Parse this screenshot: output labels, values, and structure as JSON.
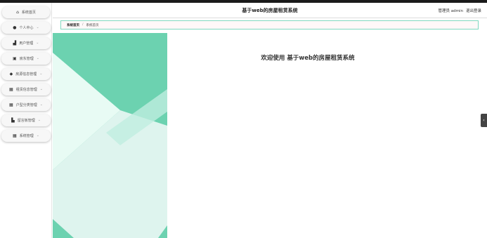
{
  "app": {
    "title": "基于web的房屋租赁系统"
  },
  "user": {
    "label": "管理员 admin",
    "logout": "退出登录"
  },
  "sidebar": {
    "items": [
      {
        "label": "系统首页",
        "icon": "home-icon",
        "glyph": "⌂",
        "chevron": ""
      },
      {
        "label": "个人中心",
        "icon": "user-icon",
        "glyph": "●",
        "chevron": "⌄"
      },
      {
        "label": "用户管理",
        "icon": "bar-chart-icon",
        "glyph": "▟",
        "chevron": "⌄"
      },
      {
        "label": "房东管理",
        "icon": "briefcase-icon",
        "glyph": "▣",
        "chevron": "⌄"
      },
      {
        "label": "房源信息管理",
        "icon": "location-pin-icon",
        "glyph": "◆",
        "chevron": "⌄"
      },
      {
        "label": "租赁信息管理",
        "icon": "grid-icon",
        "glyph": "▦",
        "chevron": "⌄"
      },
      {
        "label": "户型分类管理",
        "icon": "grid-icon",
        "glyph": "▦",
        "chevron": "⌄"
      },
      {
        "label": "留言板管理",
        "icon": "message-icon",
        "glyph": "▙",
        "chevron": "⌄"
      },
      {
        "label": "系统管理",
        "icon": "grid-icon",
        "glyph": "▦",
        "chevron": "⌄"
      }
    ]
  },
  "breadcrumb": {
    "root": "系统首页",
    "separator": "/",
    "current": "系统首页"
  },
  "main": {
    "welcome": "欢迎使用 基于web的房屋租赁系统"
  },
  "colors": {
    "accent": "#6cd2b0",
    "border": "#7fd8bf",
    "panel_light": "#d9f7ee"
  },
  "side_tab": {
    "glyph": "‹"
  }
}
